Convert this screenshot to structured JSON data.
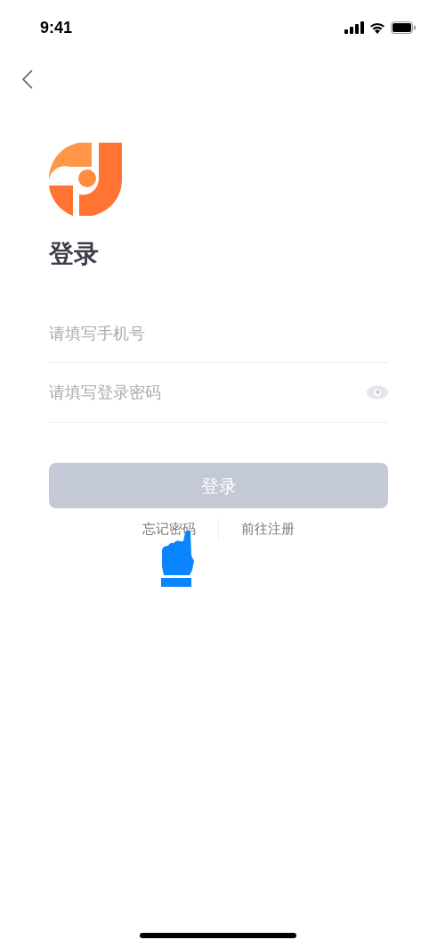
{
  "status_bar": {
    "time": "9:41"
  },
  "title": "登录",
  "phone_field": {
    "placeholder": "请填写手机号"
  },
  "password_field": {
    "placeholder": "请填写登录密码"
  },
  "login_button": {
    "label": "登录",
    "disabled": true
  },
  "links": [
    {
      "label": "忘记密码"
    },
    {
      "label": "前往注册"
    }
  ]
}
